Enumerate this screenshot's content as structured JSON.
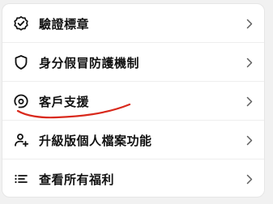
{
  "menu": {
    "items": [
      {
        "label": "驗證標章",
        "icon": "verified-badge-icon"
      },
      {
        "label": "身分假冒防護機制",
        "icon": "shield-icon"
      },
      {
        "label": "客戶支援",
        "icon": "support-headset-icon"
      },
      {
        "label": "升級版個人檔案功能",
        "icon": "add-person-icon"
      },
      {
        "label": "查看所有福利",
        "icon": "list-icon"
      }
    ],
    "chevron_icon": "chevron-right-icon"
  },
  "annotation": {
    "type": "red-underline",
    "target": "客戶支援",
    "color": "#d9291c"
  },
  "colors": {
    "background": "#f1f1f1",
    "card": "#ffffff",
    "text": "#111111",
    "chevron": "#606060",
    "divider": "#eeeeee"
  }
}
